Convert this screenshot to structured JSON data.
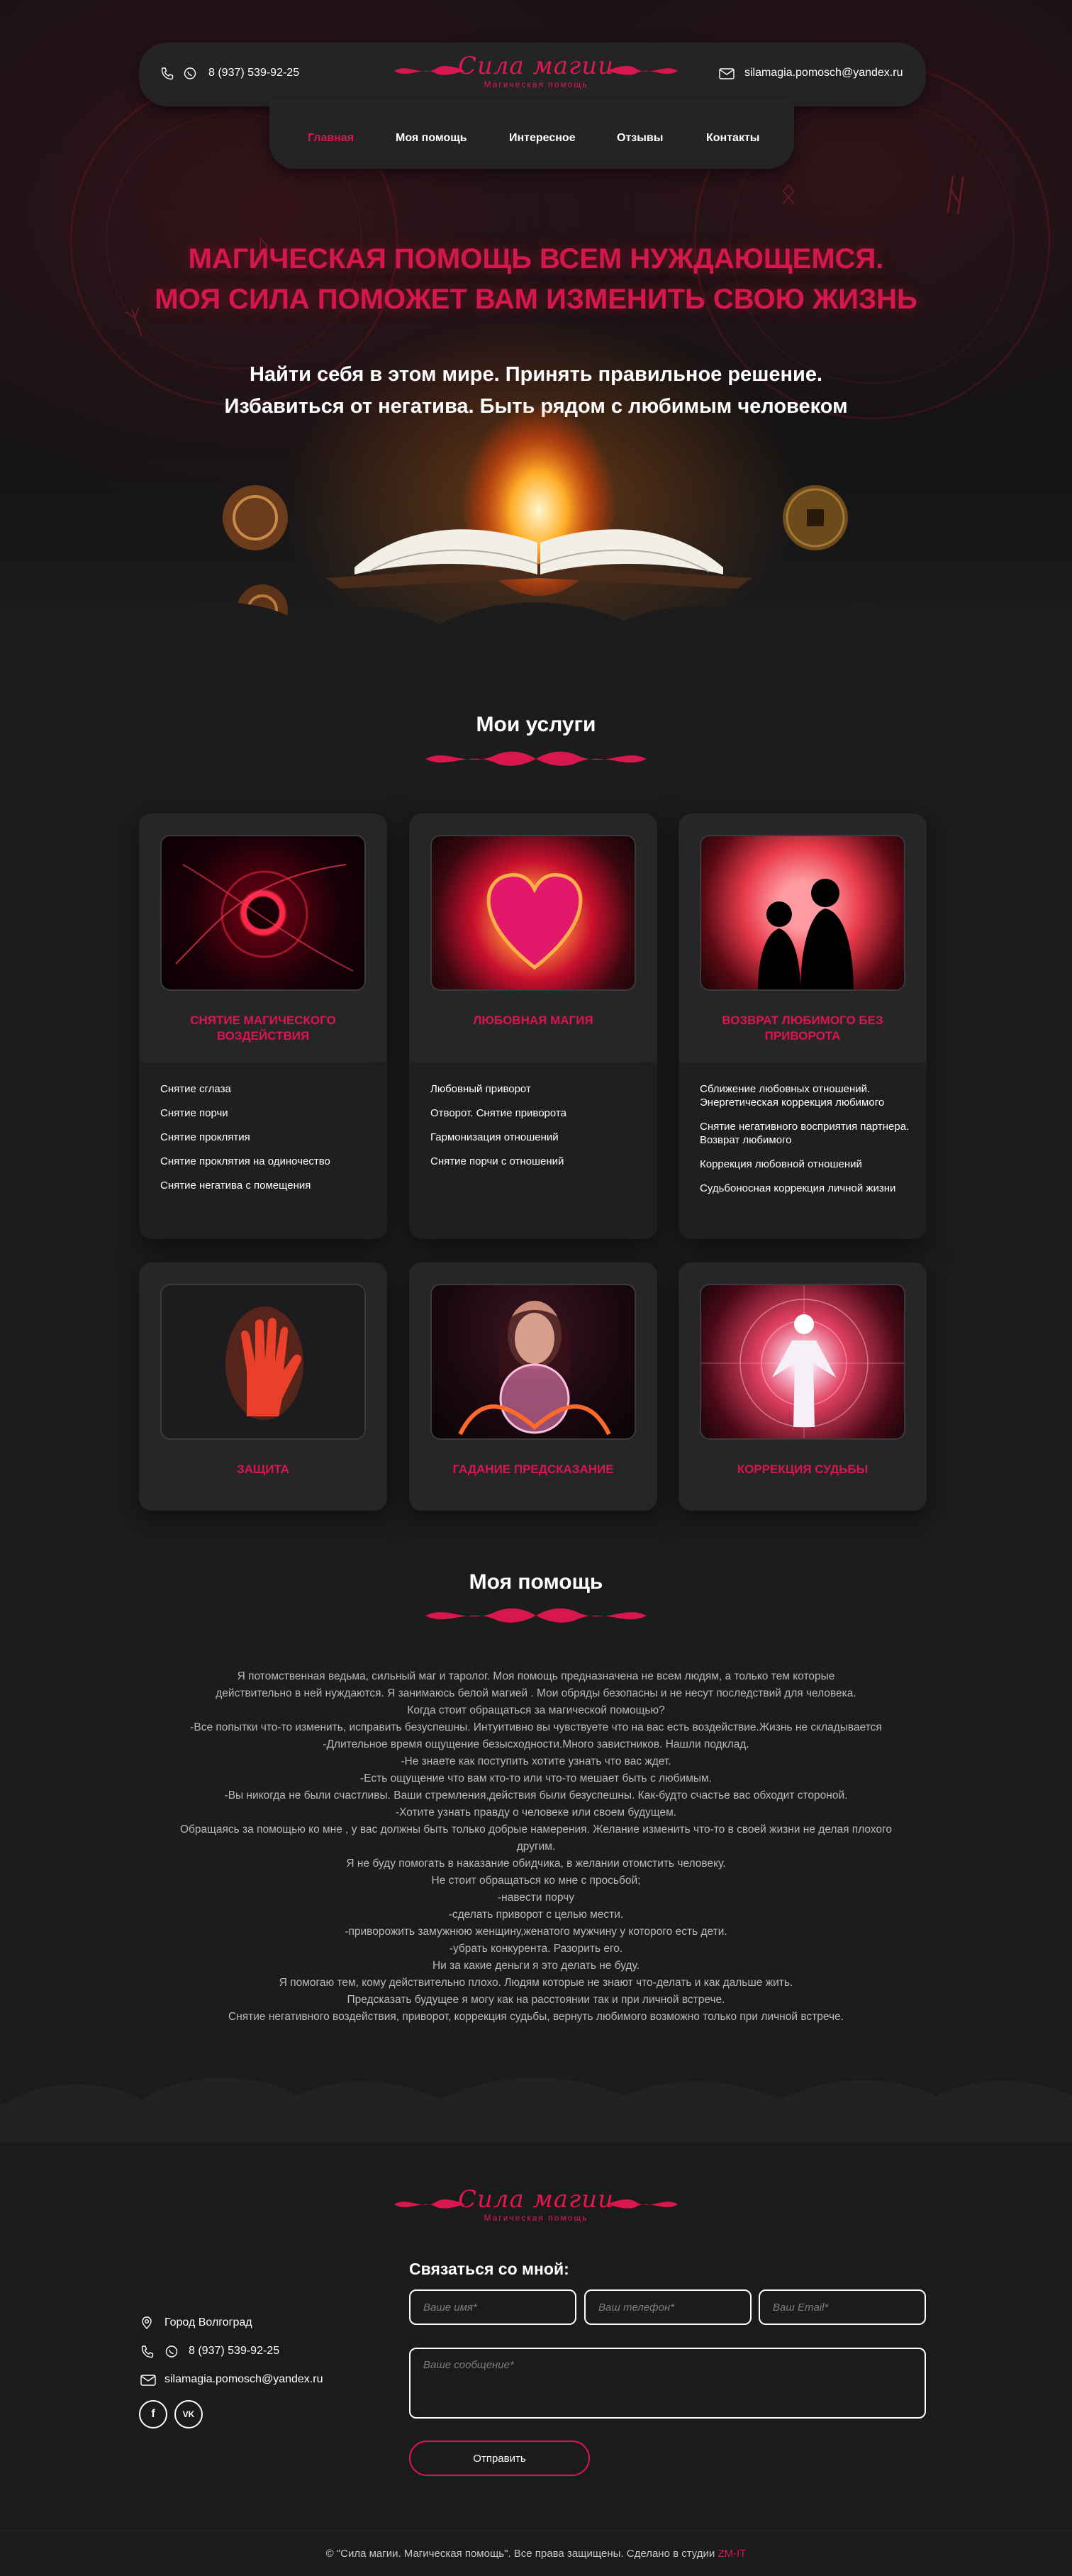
{
  "header": {
    "phone": "8 (937) 539-92-25",
    "email": "silamagia.pomosch@yandex.ru",
    "logo": {
      "name": "Сила магии",
      "subtitle": "Магическая помощь"
    },
    "nav": [
      {
        "label": "Главная",
        "active": true
      },
      {
        "label": "Моя помощь",
        "active": false
      },
      {
        "label": "Интересное",
        "active": false
      },
      {
        "label": "Отзывы",
        "active": false
      },
      {
        "label": "Контакты",
        "active": false
      }
    ]
  },
  "hero": {
    "title_line1": "МАГИЧЕСКАЯ ПОМОЩЬ ВСЕМ НУЖДАЮЩЕМСЯ.",
    "title_line2": "МОЯ СИЛА ПОМОЖЕТ ВАМ ИЗМЕНИТЬ СВОЮ ЖИЗНЬ",
    "subtitle_line1": "Найти себя в этом мире. Принять правильное решение.",
    "subtitle_line2": "Избавиться от негатива. Быть рядом с любимым человеком"
  },
  "services": {
    "title": "Мои услуги",
    "cards": [
      {
        "title": "Снятие магического воздействия",
        "image": "red-eye-vortex",
        "items": [
          "Снятие сглаза",
          "Снятие порчи",
          "Снятие проклятия",
          "Снятие проклятия на одиночество",
          "Снятие негатива с помещения"
        ]
      },
      {
        "title": "Любовная магия",
        "image": "fire-heart",
        "items": [
          "Любовный приворот",
          "Отворот. Снятие приворота",
          "Гармонизация отношений",
          "Снятие порчи с отношений"
        ]
      },
      {
        "title": "Возврат любимого без приворота",
        "image": "couple-heart",
        "items": [
          "Сближение любовных отношений. Энергетическая коррекция любимого",
          "Снятие негативного восприятия партнера. Возврат любимого",
          "Коррекция любовной отношений",
          "Судьбоносная коррекция личной жизни"
        ]
      },
      {
        "title": "Защита",
        "image": "burning-hand",
        "items": []
      },
      {
        "title": "Гадание предсказание",
        "image": "crystal-ball",
        "items": []
      },
      {
        "title": "Коррекция судьбы",
        "image": "energy-body",
        "items": []
      }
    ]
  },
  "help": {
    "title": "Моя помощь",
    "paragraphs": [
      "Я потомственная ведьма, сильный маг и таролог. Моя помощь предназначена не всем людям, а только тем которые",
      "действительно в ней нуждаются. Я занимаюсь белой магией . Мои обряды безопасны и не несут последствий для человека.",
      "Когда стоит обращаться за магической помощью?",
      "-Все попытки что-то изменить, исправить безуспешны. Интуитивно вы чувствуете что на вас есть воздействие.Жизнь не складывается",
      "-Длительное время ощущение безысходности.Много завистников. Нашли подклад.",
      "-Не знаете как поступить хотите узнать что вас ждет.",
      "-Есть ощущение что вам кто-то или что-то мешает быть с любимым.",
      "-Вы никогда не были счастливы. Ваши стремления,действия были безуспешны. Как-будто счастье вас обходит стороной.",
      "-Хотите узнать правду о человеке или своем будущем.",
      "Обращаясь за помощью ко мне , у вас должны быть только добрые намерения. Желание изменить что-то в своей жизни не делая плохого",
      "другим.",
      "Я не буду помогать в наказание обидчика, в желании отомстить человеку.",
      "Не стоит обращаться ко мне с просьбой;",
      "-навести порчу",
      "-сделать приворот с целью мести.",
      "-приворожить замужнюю женщину,женатого мужчину у которого есть дети.",
      "-убрать конкурента. Разорить его.",
      "Ни за какие деньги я это делать не буду.",
      "Я помогаю тем, кому действительно плохо. Людям которые не знают что-делать и как дальше жить.",
      "Предсказать будущее я могу как на расстоянии так и при личной встрече.",
      "Снятие негативного воздействия, приворот, коррекция судьбы, вернуть любимого возможно только при личной встрече."
    ]
  },
  "footer": {
    "city": "Город Волгоград",
    "phone": "8 (937) 539-92-25",
    "email": "silamagia.pomosch@yandex.ru",
    "social": [
      "f",
      "VK"
    ],
    "contact_title": "Связаться со мной:",
    "name_placeholder": "Ваше имя*",
    "phone_placeholder": "Ваш телефон*",
    "email_placeholder": "Ваш Email*",
    "message_placeholder": "Ваше сообщение*",
    "send_label": "Отправить",
    "copyright": "© \"Сила магии. Магическая помощь\". Все права защищены. Сделано в студии ",
    "studio": "ZM-IT"
  },
  "colors": {
    "accent": "#d9174e",
    "background": "#1c1c1d",
    "card": "#1f1f21",
    "text_muted": "#b9b9bb"
  }
}
